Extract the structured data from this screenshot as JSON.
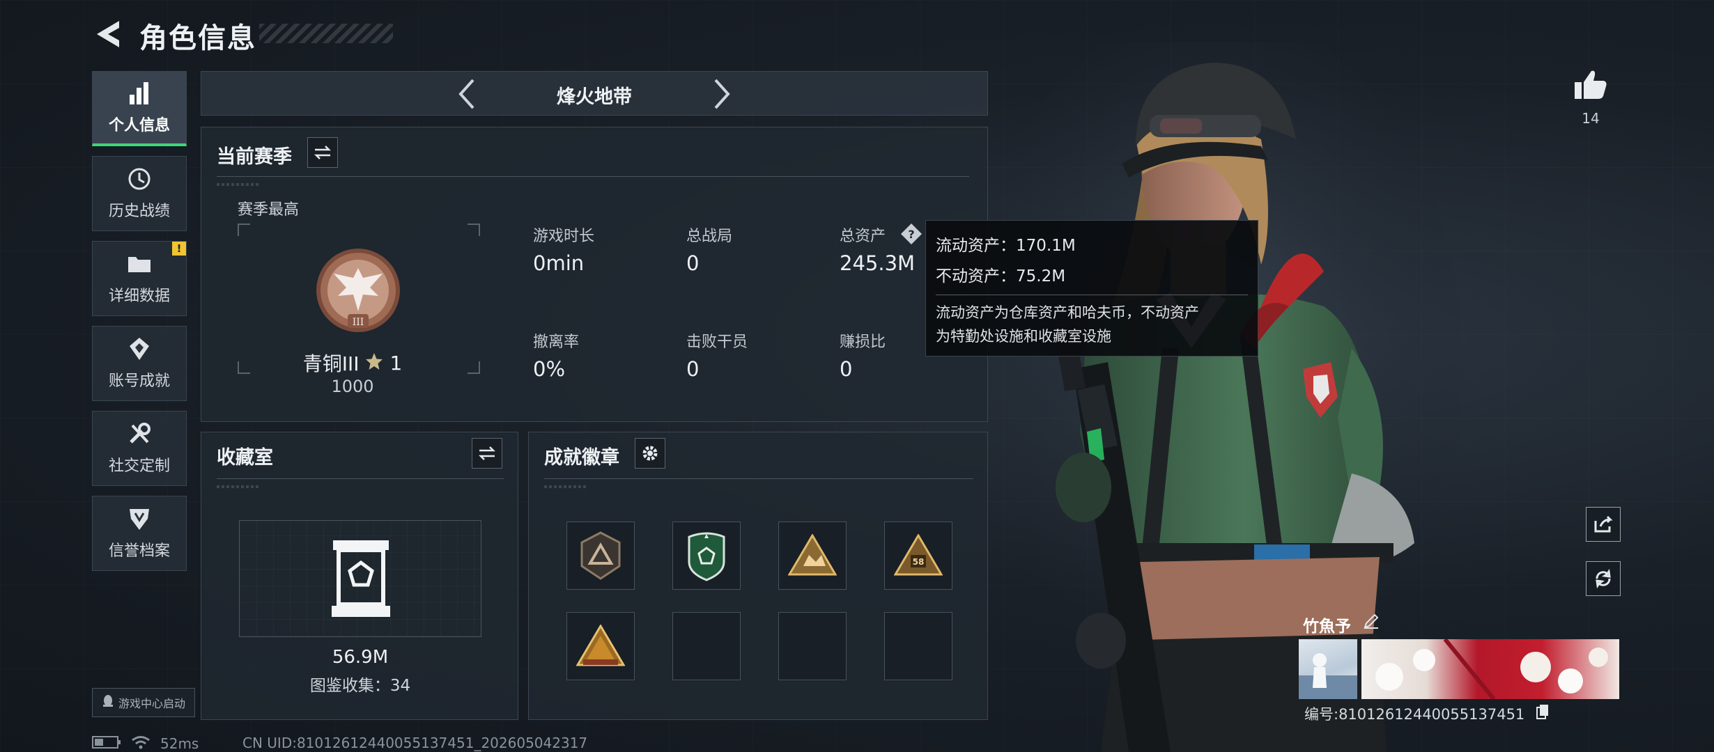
{
  "header": {
    "title": "角色信息"
  },
  "nav": {
    "items": [
      {
        "label": "个人信息",
        "active": true,
        "icon": "bar-chart-icon"
      },
      {
        "label": "历史战绩",
        "active": false,
        "icon": "history-icon"
      },
      {
        "label": "详细数据",
        "active": false,
        "icon": "folder-icon",
        "badge": "!"
      },
      {
        "label": "账号成就",
        "active": false,
        "icon": "achievement-icon"
      },
      {
        "label": "社交定制",
        "active": false,
        "icon": "tools-icon"
      },
      {
        "label": "信誉档案",
        "active": false,
        "icon": "shield-icon"
      }
    ],
    "game_center_label": "游戏中心启动"
  },
  "mode": {
    "title": "烽火地带"
  },
  "season": {
    "title": "当前赛季",
    "best_label": "赛季最高",
    "rank_name": "青铜III",
    "rank_stars": "1",
    "rank_points": "1000",
    "stats": [
      {
        "label": "游戏时长",
        "value": "0min"
      },
      {
        "label": "总战局",
        "value": "0"
      },
      {
        "label": "总资产",
        "value": "245.3M"
      },
      {
        "label": "撤离率",
        "value": "0%"
      },
      {
        "label": "击败干员",
        "value": "0"
      },
      {
        "label": "赚损比",
        "value": "0"
      }
    ]
  },
  "tooltip": {
    "liquid": "流动资产：170.1M",
    "fixed": "不动资产：75.2M",
    "note_line1": "流动资产为仓库资产和哈夫币，不动资产",
    "note_line2": "为特勤处设施和收藏室设施"
  },
  "collection": {
    "title": "收藏室",
    "value": "56.9M",
    "catalog": "图鉴收集：34"
  },
  "badges": {
    "title": "成就徽章",
    "slots": [
      "bronze-triangle-badge",
      "green-shield-badge",
      "gold-triangle-badge",
      "gold-58-badge",
      "gold-pyramid-badge",
      "",
      "",
      ""
    ],
    "badge_58_text": "58"
  },
  "player": {
    "likes": "14",
    "name": "竹魚予",
    "id": "编号:81012612440055137451"
  },
  "footer": {
    "ping": "52ms",
    "uid": "CN UID:81012612440055137451_202605042317"
  },
  "colors": {
    "accent_green": "#3ed67a",
    "alert_yellow": "#f0c531",
    "panel_bg": "#202831",
    "rank_bronze": "#a06b55"
  }
}
